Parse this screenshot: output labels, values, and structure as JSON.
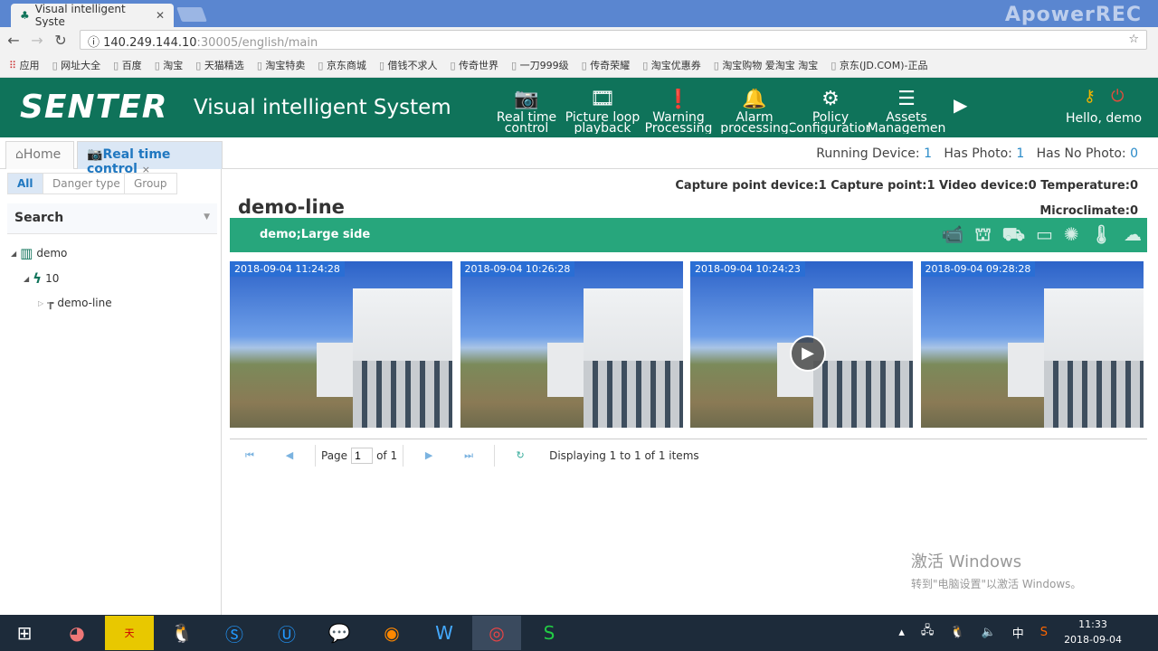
{
  "browser": {
    "tab_title": "Visual intelligent Syste",
    "url_host": "140.249.144.10",
    "url_rest": ":30005/english/main",
    "watermark": "ApowerREC",
    "bookmarks": [
      "应用",
      "网址大全",
      "百度",
      "淘宝",
      "天猫精选",
      "淘宝特卖",
      "京东商城",
      "借钱不求人",
      "传奇世界",
      "一刀999级",
      "传奇荣耀",
      "淘宝优惠券",
      "淘宝购物 爱淘宝 淘宝",
      "京东(JD.COM)-正品"
    ]
  },
  "header": {
    "logo": "SENTER",
    "title": "Visual intelligent System",
    "menu": [
      {
        "l1": "Real time",
        "l2": "control",
        "icon": "📷"
      },
      {
        "l1": "Picture loop",
        "l2": "playback",
        "icon": "🎞"
      },
      {
        "l1": "Warning",
        "l2": "Processing",
        "icon": "❗"
      },
      {
        "l1": "Alarm",
        "l2": "processing",
        "icon": "🔔"
      },
      {
        "l1": "Policy",
        "l2": "Configuration",
        "icon": "⚙"
      },
      {
        "l1": "Assets",
        "l2": "Managemen",
        "icon": "☰"
      }
    ],
    "greeting": "Hello, demo"
  },
  "tabs": {
    "home": "Home",
    "active": "Real time control",
    "close": "×"
  },
  "stats": {
    "running_label": "Running Device:",
    "running": "1",
    "photo_label": "Has Photo:",
    "photo": "1",
    "nophoto_label": "Has No Photo:",
    "nophoto": "0"
  },
  "sidebar": {
    "tabs": [
      "All",
      "Danger type",
      "Group"
    ],
    "search": "Search",
    "tree": [
      "demo",
      "10",
      "demo-line"
    ]
  },
  "main": {
    "capture": "Capture point device:1 Capture point:1 Video device:0 Temperature:0",
    "microclimate": "Microclimate:0",
    "line_title": "demo-line",
    "bar_label": "demo;Large side",
    "photos": [
      "2018-09-04 11:24:28",
      "2018-09-04 10:26:28",
      "2018-09-04 10:24:23",
      "2018-09-04 09:28:28"
    ],
    "pager": {
      "page_label": "Page",
      "page": "1",
      "of": "of 1",
      "display": "Displaying 1 to 1 of 1 items"
    }
  },
  "activation": {
    "line1": "激活 Windows",
    "line2": "转到\"电脑设置\"以激活 Windows。"
  },
  "taskbar": {
    "ime": "中",
    "time": "11:33",
    "date": "2018-09-04"
  }
}
